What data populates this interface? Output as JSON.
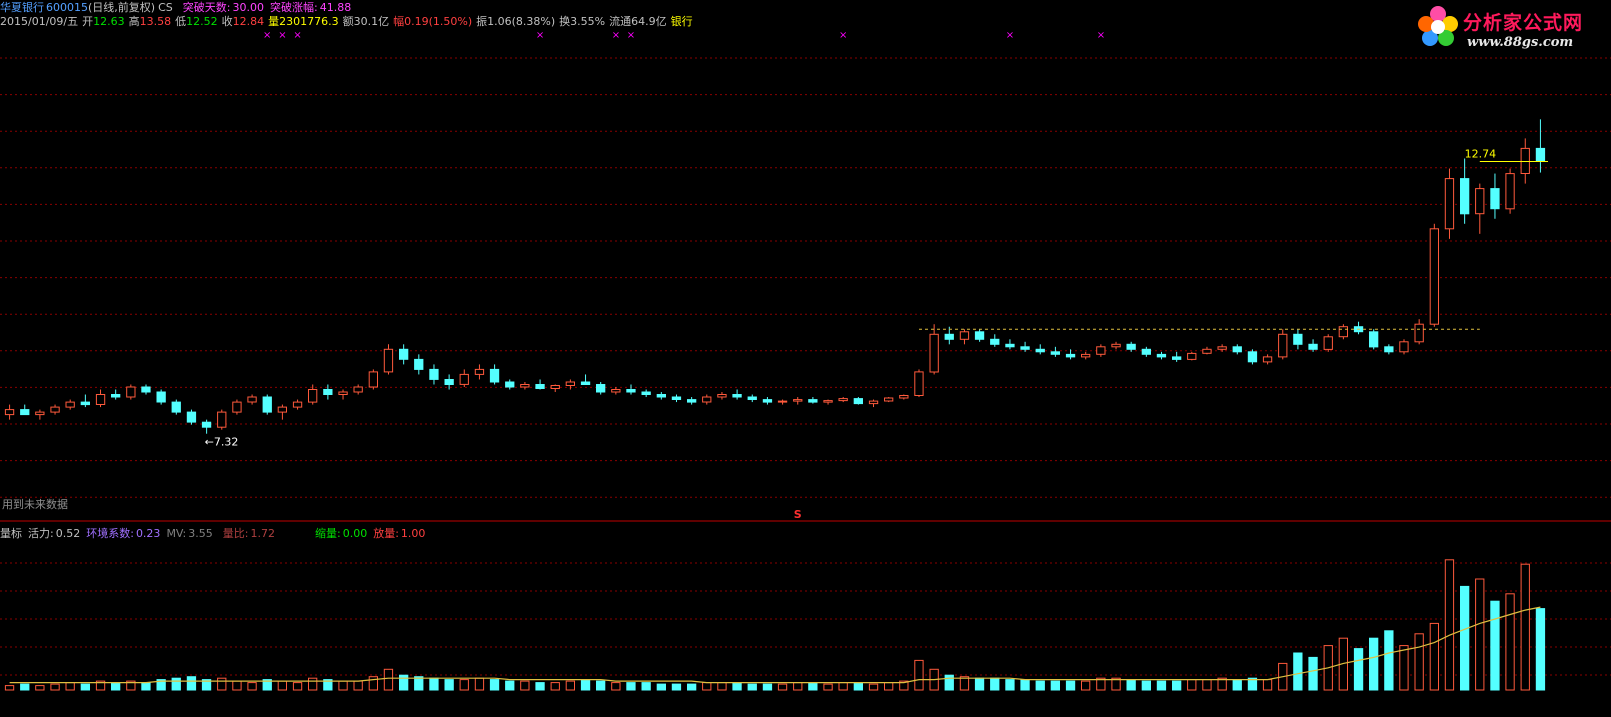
{
  "header": {
    "stock_name": "华夏银行",
    "stock_code": "600015",
    "period": "(日线,前复权)",
    "formula": "CS",
    "breakout_days_label": "突破天数:",
    "breakout_days": "30.00",
    "breakout_gain_label": "突破涨幅:",
    "breakout_gain": "41.88",
    "date": "2015/01/09/五",
    "open_label": "开",
    "open": "12.63",
    "high_label": "高",
    "high": "13.58",
    "low_label": "低",
    "low": "12.52",
    "close_label": "收",
    "close": "12.84",
    "volume_label": "量",
    "volume": "2301776.3",
    "amount_label": "额",
    "amount": "30.1亿",
    "change_label": "幅",
    "change": "0.19(1.50%)",
    "amplitude_label": "振",
    "amplitude": "1.06(8.38%)",
    "turnover_label": "换",
    "turnover": "3.55%",
    "float_label": "流通",
    "float_cap": "64.9亿",
    "sector": "银行"
  },
  "notes": {
    "future_data": "用到未来数据",
    "low_marker": "←7.32",
    "last_price_marker": "12.74",
    "s_marker": "S",
    "x_marker": "×"
  },
  "indicator": {
    "name": "量标",
    "vitality_label": "活力:",
    "vitality": "0.52",
    "env_label": "环境系数:",
    "env": "0.23",
    "mv_label": "MV:",
    "mv": "3.55",
    "vol_ratio_label": "量比:",
    "vol_ratio": "1.72",
    "shrink_label": "缩量:",
    "shrink": "0.00",
    "expand_label": "放量:",
    "expand": "1.00"
  },
  "logo": {
    "title": "分析家公式网",
    "url": "www.88gs.com"
  },
  "colors": {
    "up": "#ff5a3c",
    "down": "#54ffff",
    "grid": "#8a0000",
    "ma": "#e0c040",
    "divider": "#c00000",
    "marker": "#ff00ff"
  },
  "chart_data": {
    "type": "candlestick",
    "price_range": [
      6.0,
      15.0
    ],
    "grid": true,
    "low_point": 7.32,
    "last_close_line": 12.74,
    "breakout_level": 9.4,
    "candles_ohlc": [
      [
        7.7,
        7.9,
        7.6,
        7.8
      ],
      [
        7.8,
        7.9,
        7.7,
        7.7
      ],
      [
        7.7,
        7.8,
        7.6,
        7.75
      ],
      [
        7.75,
        7.9,
        7.7,
        7.85
      ],
      [
        7.85,
        8.0,
        7.8,
        7.95
      ],
      [
        7.95,
        8.1,
        7.85,
        7.9
      ],
      [
        7.9,
        8.2,
        7.85,
        8.1
      ],
      [
        8.1,
        8.2,
        8.0,
        8.05
      ],
      [
        8.05,
        8.3,
        8.0,
        8.25
      ],
      [
        8.25,
        8.3,
        8.1,
        8.15
      ],
      [
        8.15,
        8.2,
        7.9,
        7.95
      ],
      [
        7.95,
        8.0,
        7.7,
        7.75
      ],
      [
        7.75,
        7.8,
        7.5,
        7.55
      ],
      [
        7.55,
        7.6,
        7.32,
        7.45
      ],
      [
        7.45,
        7.8,
        7.4,
        7.75
      ],
      [
        7.75,
        8.0,
        7.7,
        7.95
      ],
      [
        7.95,
        8.1,
        7.9,
        8.05
      ],
      [
        8.05,
        8.1,
        7.7,
        7.75
      ],
      [
        7.75,
        7.9,
        7.6,
        7.85
      ],
      [
        7.85,
        8.0,
        7.8,
        7.95
      ],
      [
        7.95,
        8.3,
        7.9,
        8.2
      ],
      [
        8.2,
        8.3,
        8.0,
        8.1
      ],
      [
        8.1,
        8.2,
        8.0,
        8.15
      ],
      [
        8.15,
        8.3,
        8.1,
        8.25
      ],
      [
        8.25,
        8.6,
        8.2,
        8.55
      ],
      [
        8.55,
        9.1,
        8.5,
        9.0
      ],
      [
        9.0,
        9.1,
        8.7,
        8.8
      ],
      [
        8.8,
        8.9,
        8.5,
        8.6
      ],
      [
        8.6,
        8.7,
        8.3,
        8.4
      ],
      [
        8.4,
        8.5,
        8.2,
        8.3
      ],
      [
        8.3,
        8.6,
        8.25,
        8.5
      ],
      [
        8.5,
        8.7,
        8.4,
        8.6
      ],
      [
        8.6,
        8.7,
        8.3,
        8.35
      ],
      [
        8.35,
        8.4,
        8.2,
        8.25
      ],
      [
        8.25,
        8.35,
        8.2,
        8.3
      ],
      [
        8.3,
        8.4,
        8.2,
        8.22
      ],
      [
        8.22,
        8.3,
        8.15,
        8.28
      ],
      [
        8.28,
        8.4,
        8.2,
        8.35
      ],
      [
        8.35,
        8.5,
        8.3,
        8.3
      ],
      [
        8.3,
        8.35,
        8.1,
        8.15
      ],
      [
        8.15,
        8.25,
        8.1,
        8.2
      ],
      [
        8.2,
        8.3,
        8.1,
        8.15
      ],
      [
        8.15,
        8.2,
        8.05,
        8.1
      ],
      [
        8.1,
        8.15,
        8.0,
        8.05
      ],
      [
        8.05,
        8.1,
        7.95,
        8.0
      ],
      [
        8.0,
        8.05,
        7.9,
        7.95
      ],
      [
        7.95,
        8.1,
        7.9,
        8.05
      ],
      [
        8.05,
        8.15,
        8.0,
        8.1
      ],
      [
        8.1,
        8.2,
        8.0,
        8.05
      ],
      [
        8.05,
        8.1,
        7.95,
        8.0
      ],
      [
        8.0,
        8.05,
        7.9,
        7.95
      ],
      [
        7.95,
        8.0,
        7.9,
        7.97
      ],
      [
        7.97,
        8.05,
        7.9,
        8.0
      ],
      [
        8.0,
        8.05,
        7.92,
        7.95
      ],
      [
        7.95,
        8.0,
        7.9,
        7.98
      ],
      [
        7.98,
        8.05,
        7.95,
        8.02
      ],
      [
        8.02,
        8.05,
        7.9,
        7.92
      ],
      [
        7.92,
        8.0,
        7.85,
        7.97
      ],
      [
        7.97,
        8.05,
        7.95,
        8.03
      ],
      [
        8.03,
        8.1,
        8.0,
        8.08
      ],
      [
        8.08,
        8.6,
        8.05,
        8.55
      ],
      [
        8.55,
        9.5,
        8.5,
        9.3
      ],
      [
        9.3,
        9.45,
        9.1,
        9.2
      ],
      [
        9.2,
        9.4,
        9.1,
        9.35
      ],
      [
        9.35,
        9.4,
        9.15,
        9.2
      ],
      [
        9.2,
        9.3,
        9.05,
        9.1
      ],
      [
        9.1,
        9.2,
        9.0,
        9.05
      ],
      [
        9.05,
        9.15,
        8.95,
        9.0
      ],
      [
        9.0,
        9.1,
        8.9,
        8.95
      ],
      [
        8.95,
        9.05,
        8.85,
        8.9
      ],
      [
        8.9,
        9.0,
        8.8,
        8.85
      ],
      [
        8.85,
        8.95,
        8.8,
        8.9
      ],
      [
        8.9,
        9.1,
        8.85,
        9.05
      ],
      [
        9.05,
        9.15,
        9.0,
        9.1
      ],
      [
        9.1,
        9.15,
        8.95,
        9.0
      ],
      [
        9.0,
        9.05,
        8.85,
        8.9
      ],
      [
        8.9,
        8.95,
        8.8,
        8.85
      ],
      [
        8.85,
        8.95,
        8.75,
        8.8
      ],
      [
        8.8,
        8.95,
        8.78,
        8.92
      ],
      [
        8.92,
        9.05,
        8.9,
        9.0
      ],
      [
        9.0,
        9.1,
        8.95,
        9.05
      ],
      [
        9.05,
        9.1,
        8.9,
        8.95
      ],
      [
        8.95,
        9.0,
        8.7,
        8.75
      ],
      [
        8.75,
        8.9,
        8.7,
        8.85
      ],
      [
        8.85,
        9.4,
        8.8,
        9.3
      ],
      [
        9.3,
        9.4,
        9.0,
        9.1
      ],
      [
        9.1,
        9.2,
        8.95,
        9.0
      ],
      [
        9.0,
        9.3,
        8.95,
        9.25
      ],
      [
        9.25,
        9.5,
        9.2,
        9.45
      ],
      [
        9.45,
        9.55,
        9.3,
        9.35
      ],
      [
        9.35,
        9.4,
        9.0,
        9.05
      ],
      [
        9.05,
        9.1,
        8.9,
        8.95
      ],
      [
        8.95,
        9.2,
        8.9,
        9.15
      ],
      [
        9.15,
        9.6,
        9.1,
        9.5
      ],
      [
        9.5,
        11.5,
        9.45,
        11.4
      ],
      [
        11.4,
        12.6,
        11.2,
        12.4
      ],
      [
        12.4,
        12.8,
        11.5,
        11.7
      ],
      [
        11.7,
        12.3,
        11.3,
        12.2
      ],
      [
        12.2,
        12.5,
        11.6,
        11.8
      ],
      [
        11.8,
        12.6,
        11.7,
        12.5
      ],
      [
        12.5,
        13.2,
        12.3,
        13.0
      ],
      [
        13.0,
        13.58,
        12.52,
        12.74
      ]
    ],
    "volume_axis_max": 100,
    "volumes": [
      3,
      4,
      3,
      4,
      5,
      4,
      6,
      5,
      6,
      5,
      7,
      8,
      9,
      7,
      8,
      6,
      5,
      7,
      6,
      5,
      8,
      7,
      6,
      6,
      9,
      14,
      10,
      9,
      8,
      7,
      7,
      8,
      7,
      6,
      6,
      5,
      5,
      6,
      7,
      6,
      5,
      5,
      5,
      4,
      4,
      4,
      5,
      5,
      5,
      4,
      4,
      4,
      5,
      5,
      4,
      5,
      5,
      4,
      5,
      6,
      20,
      14,
      10,
      9,
      8,
      8,
      7,
      7,
      6,
      6,
      6,
      6,
      8,
      8,
      7,
      6,
      6,
      6,
      7,
      7,
      8,
      7,
      8,
      7,
      18,
      25,
      22,
      30,
      35,
      28,
      35,
      40,
      30,
      38,
      45,
      88,
      70,
      75,
      60,
      65,
      85,
      55
    ],
    "ma_volume": [
      5,
      5,
      5,
      5,
      5,
      5,
      5,
      5,
      5,
      5,
      6,
      6,
      6,
      6,
      6,
      6,
      6,
      6,
      6,
      6,
      6,
      6,
      6,
      6,
      7,
      8,
      8,
      8,
      8,
      8,
      8,
      8,
      8,
      7,
      7,
      7,
      7,
      7,
      7,
      7,
      6,
      6,
      6,
      6,
      6,
      6,
      5,
      5,
      5,
      5,
      5,
      5,
      5,
      5,
      5,
      5,
      5,
      5,
      5,
      5,
      7,
      7,
      8,
      8,
      8,
      8,
      8,
      7,
      7,
      7,
      7,
      7,
      7,
      7,
      7,
      7,
      7,
      7,
      7,
      7,
      7,
      7,
      7,
      7,
      9,
      11,
      13,
      15,
      18,
      20,
      22,
      25,
      27,
      29,
      32,
      37,
      41,
      45,
      48,
      51,
      54,
      56
    ],
    "x_marker_positions": [
      17,
      18,
      19,
      35,
      40,
      41,
      55,
      66,
      72
    ]
  }
}
